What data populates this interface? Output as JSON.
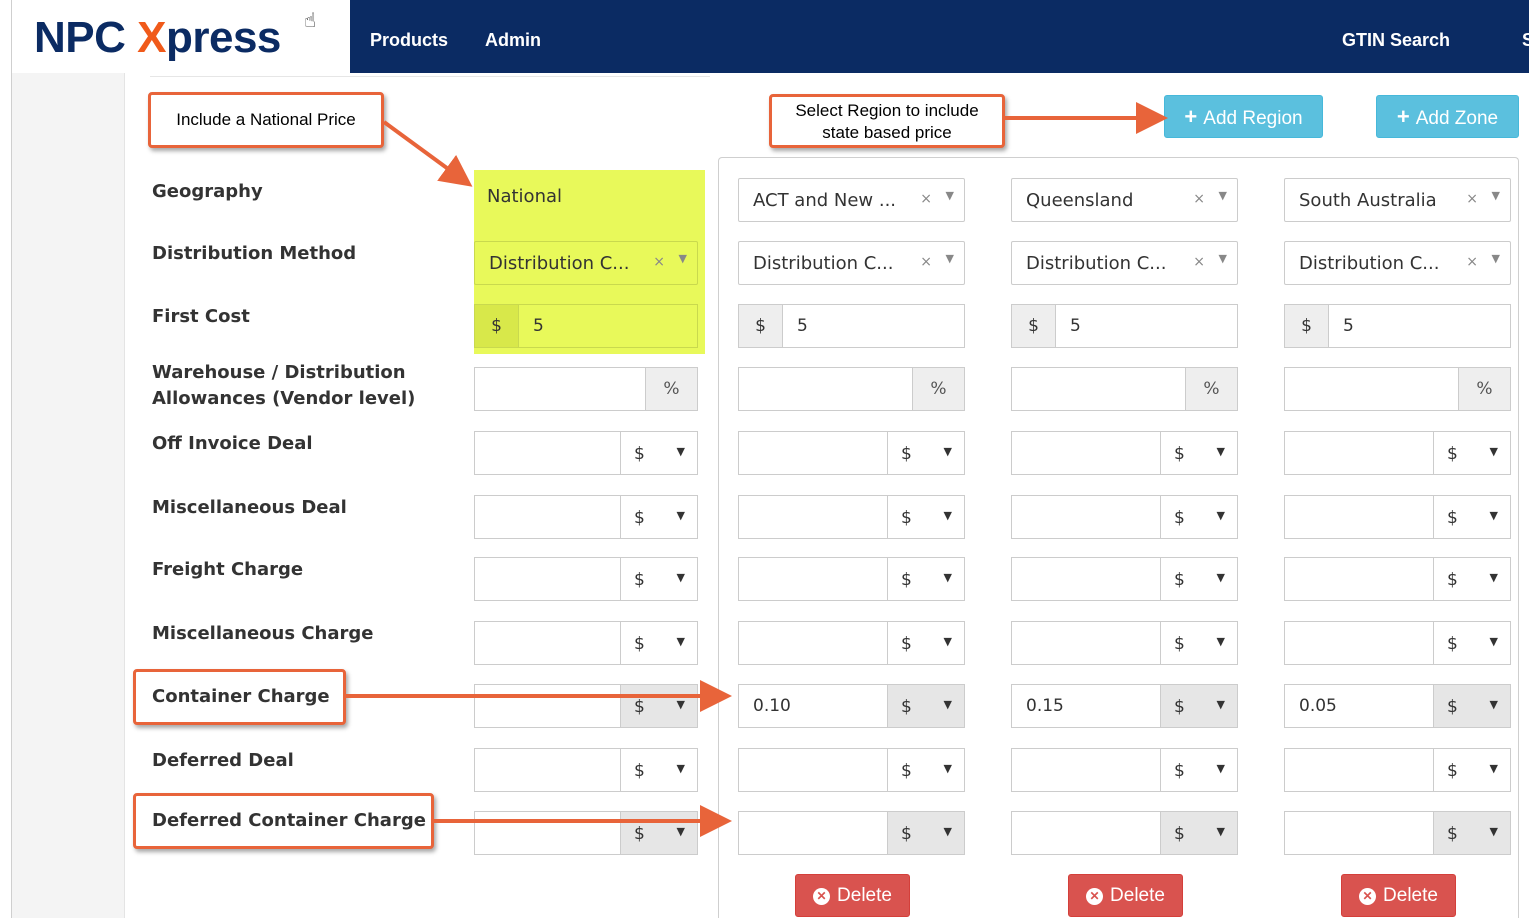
{
  "brand": {
    "npc": "NPC ",
    "x": "X",
    "press": "press"
  },
  "nav": {
    "products": "Products",
    "admin": "Admin",
    "gtin_search": "GTIN Search",
    "cut_item": "S"
  },
  "labels": {
    "geography": "Geography",
    "distribution_method": "Distribution Method",
    "first_cost": "First Cost",
    "warehouse_line1": "Warehouse / Distribution",
    "warehouse_line2": "Allowances (Vendor level)",
    "off_invoice_deal": "Off Invoice Deal",
    "misc_deal": "Miscellaneous Deal",
    "freight_charge": "Freight Charge",
    "misc_charge": "Miscellaneous Charge",
    "container_charge": "Container Charge",
    "deferred_deal": "Deferred Deal",
    "deferred_container_charge": "Deferred Container Charge"
  },
  "callouts": {
    "national": "Include a National Price",
    "region_line1": "Select Region to include",
    "region_line2": "state based price"
  },
  "buttons": {
    "add_region": "Add Region",
    "add_zone": "Add Zone",
    "delete": "Delete"
  },
  "icons": {
    "add": "plus-icon",
    "delete": "times-circle-icon",
    "clear": "times-icon",
    "dropdown": "caret-down-icon"
  },
  "symbols": {
    "currency": "$",
    "percent": "%",
    "clear": "×",
    "caret": "▼"
  },
  "national": {
    "geography": "National",
    "distribution": "Distribution C...",
    "first_cost": "5"
  },
  "regions": [
    {
      "geography": "ACT and New ...",
      "distribution": "Distribution C...",
      "first_cost": "5",
      "container_charge": "0.10"
    },
    {
      "geography": "Queensland",
      "distribution": "Distribution C...",
      "first_cost": "5",
      "container_charge": "0.15"
    },
    {
      "geography": "South Australia",
      "distribution": "Distribution C...",
      "first_cost": "5",
      "container_charge": "0.05"
    }
  ],
  "colors": {
    "navbar": "#0b2b63",
    "brand_orange": "#f05a1a",
    "highlight": "#e8f95a",
    "info": "#5bc0de",
    "danger": "#d9534f",
    "callout_border": "#e8643a"
  }
}
